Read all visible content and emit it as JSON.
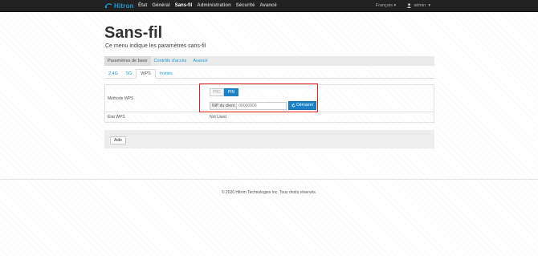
{
  "brand": {
    "name": "Hitron",
    "color": "#1d9ad6"
  },
  "nav": {
    "items": [
      "État",
      "Général",
      "Sans-fil",
      "Administration",
      "Sécurité",
      "Avancé"
    ],
    "active": "Sans-fil",
    "language": "Français",
    "user": "admin"
  },
  "page": {
    "title": "Sans-fil",
    "subtitle": "Ce menu indique les paramètres sans-fil"
  },
  "tabs_main": [
    "Paramètres de base",
    "Contrôle d'accès",
    "Avancé"
  ],
  "tabs_sub": [
    "2.4G",
    "5G",
    "WPS",
    "Invités"
  ],
  "wps": {
    "method_label": "Méthode WPS",
    "pbc_label": "PBC",
    "pin_label": "PIN",
    "selected": "PIN",
    "client_pin_label": "NIP du client",
    "client_pin_value": "00000000",
    "start_label": "Démarrer",
    "status_label": "État WPS",
    "status_value": "Not Used"
  },
  "help_label": "Aide",
  "footer": "© 2026 Hitron Technologies Inc. Tous droits réservés.",
  "colors": {
    "primary": "#1d83c6",
    "highlight": "#e02020",
    "navbar": "#222222"
  }
}
